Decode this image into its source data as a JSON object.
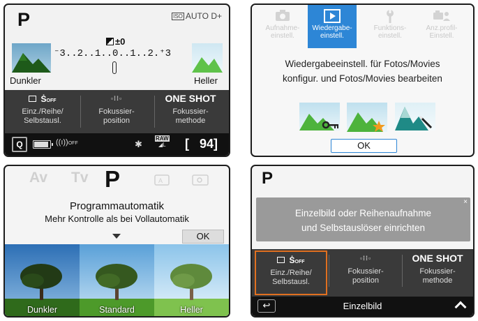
{
  "panel1": {
    "mode": "P",
    "iso_badge": "ISO",
    "iso_text": "AUTO D+",
    "exposure_comp": "±0",
    "scale": "⁻3..2..1..0..1..2.⁺3",
    "dark_label": "Dunkler",
    "light_label": "Heller",
    "items": [
      {
        "value": "☐ Ṡ",
        "label": "Einz./Reihe/\nSelbstausl."
      },
      {
        "value": "▫▯▯▫",
        "label": "Fokussier-\nposition"
      },
      {
        "value": "ONE SHOT",
        "label": "Fokussier-\nmethode"
      }
    ],
    "footer": {
      "q_label": "Q",
      "wifi": "((ı))",
      "bt": "✱",
      "raw": "RAW",
      "raw_size": "◢L",
      "shots": "[   94]"
    }
  },
  "panel2": {
    "tabs": [
      {
        "label": "Aufnahme-\neinstell.",
        "icon": "camera-icon",
        "selected": false
      },
      {
        "label": "Wiedergabe-\neinstell.",
        "icon": "play-icon",
        "selected": true
      },
      {
        "label": "Funktions-\neinstell.",
        "icon": "wrench-icon",
        "selected": false
      },
      {
        "label": "Anz.profil-\nEinstell.",
        "icon": "camera-profile-icon",
        "selected": false
      }
    ],
    "description": "Wiedergabeeinstell. für Fotos/Movies\nkonfigur. und Fotos/Movies bearbeiten",
    "ok_label": "OK"
  },
  "panel3": {
    "modes": [
      "Av",
      "Tv",
      "P"
    ],
    "title": "Programmautomatik",
    "subtitle": "Mehr Kontrolle als bei Vollautomatik",
    "ok_label": "OK",
    "previews": [
      "Dunkler",
      "Standard",
      "Heller"
    ]
  },
  "panel4": {
    "mode": "P",
    "popup_text": "Einzelbild oder Reihenaufnahme\nund Selbstauslöser einrichten",
    "popup_close": "×",
    "items": [
      {
        "value": "☐ Ṡ",
        "label": "Einz./Reihe/\nSelbstausl."
      },
      {
        "value": "▫▯▯▫",
        "label": "Fokussier-\nposition"
      },
      {
        "value": "ONE SHOT",
        "label": "Fokussier-\nmethode"
      }
    ],
    "footer_text": "Einzelbild",
    "back_label": "↩"
  }
}
